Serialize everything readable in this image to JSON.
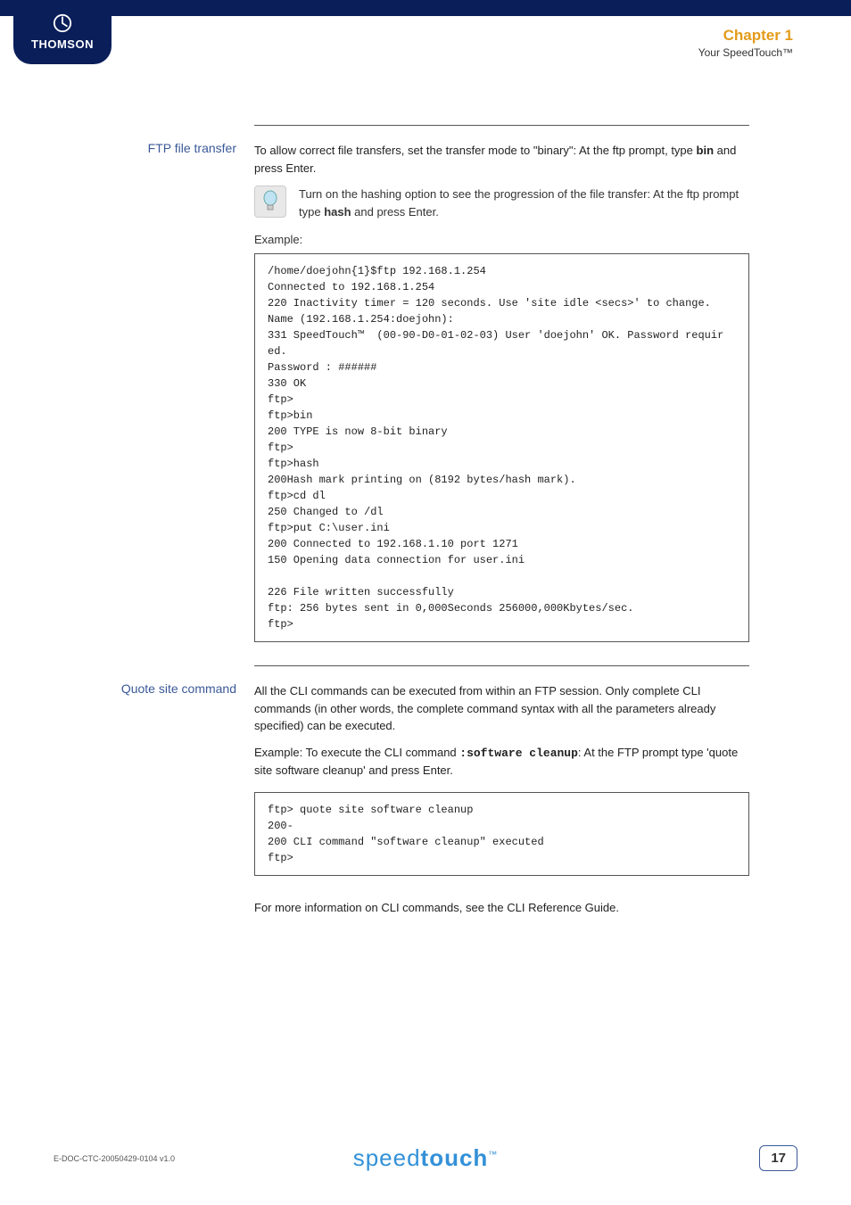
{
  "header": {
    "logo_text": "THOMSON",
    "chapter_title": "Chapter 1",
    "chapter_sub": "Your SpeedTouch™"
  },
  "section1": {
    "label": "FTP file transfer",
    "para_before_bin": "To allow correct file transfers, set the transfer mode to \"binary\": At the ftp prompt, type ",
    "bin_word": "bin",
    "para_after_bin": " and press Enter.",
    "note_before_hash": "Turn on the hashing option to see the progression of the file transfer: At the ftp prompt type ",
    "hash_word": "hash",
    "note_after_hash": " and press Enter.",
    "example_label": "Example:",
    "code": "/home/doejohn{1}$ftp 192.168.1.254\nConnected to 192.168.1.254\n220 Inactivity timer = 120 seconds. Use 'site idle <secs>' to change.\nName (192.168.1.254:doejohn):\n331 SpeedTouch™  (00-90-D0-01-02-03) User 'doejohn' OK. Password requir\ned.\nPassword : ######\n330 OK\nftp>\nftp>bin\n200 TYPE is now 8-bit binary\nftp>\nftp>hash\n200Hash mark printing on (8192 bytes/hash mark).\nftp>cd dl\n250 Changed to /dl\nftp>put C:\\user.ini\n200 Connected to 192.168.1.10 port 1271\n150 Opening data connection for user.ini\n\n226 File written successfully\nftp: 256 bytes sent in 0,000Seconds 256000,000Kbytes/sec.\nftp>"
  },
  "section2": {
    "label": "Quote site command",
    "para1": "All the CLI commands can be executed from within an FTP session. Only complete CLI commands (in other words, the complete command syntax with all the parameters already specified) can be executed.",
    "para2_before": "Example: To execute the CLI command ",
    "cmd": ":software cleanup",
    "para2_after": ": At the FTP prompt type 'quote site software cleanup' and press Enter.",
    "code": "ftp> quote site software cleanup\n200-\n200 CLI command \"software cleanup\" executed\nftp>",
    "para3": "For more information on CLI commands, see the CLI Reference Guide."
  },
  "footer": {
    "doc_id": "E-DOC-CTC-20050429-0104 v1.0",
    "brand_light": "speed",
    "brand_bold": "touch",
    "tm": "™",
    "page_number": "17"
  }
}
